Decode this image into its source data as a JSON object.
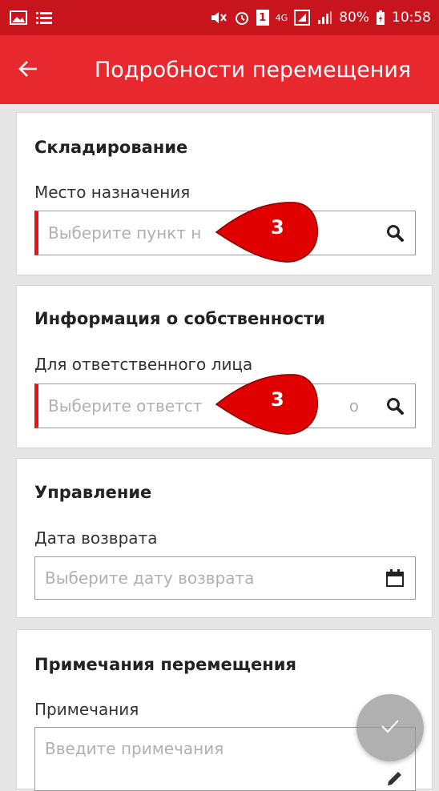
{
  "status_bar": {
    "battery": "80%",
    "time": "10:58",
    "network": "4G",
    "sim": "1"
  },
  "app_bar": {
    "title": "Подробности перемещения"
  },
  "storage": {
    "heading": "Складирование",
    "label": "Место назначения",
    "placeholder": "Выберите пункт н"
  },
  "ownership": {
    "heading": "Информация о собственности",
    "label": "Для ответственного лица",
    "placeholder": "Выберите ответст",
    "placeholder_tail": "о"
  },
  "management": {
    "heading": "Управление",
    "label": "Дата возврата",
    "placeholder": "Выберите дату возврата"
  },
  "notes": {
    "heading": "Примечания перемещения",
    "label": "Примечания",
    "placeholder": "Введите примечания"
  },
  "annotations": [
    {
      "number": "3"
    },
    {
      "number": "3"
    }
  ],
  "colors": {
    "status_bar": "#c8141c",
    "app_bar": "#e8282f",
    "required_marker": "#ee1111",
    "badge": "#e10000"
  },
  "icons": {
    "back": "arrow-left-icon",
    "search": "search-icon",
    "calendar": "calendar-icon",
    "edit": "pencil-icon",
    "confirm": "check-icon"
  }
}
